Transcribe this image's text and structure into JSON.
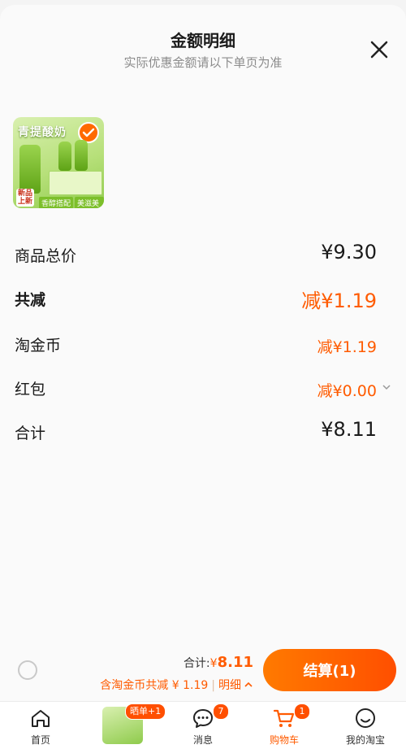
{
  "header": {
    "title": "金额明细",
    "subtitle": "实际优惠金额请以下单页为准",
    "close_icon": "close-icon"
  },
  "product": {
    "thumb_title": "青提酸奶",
    "new_tag": "新品\n上新",
    "tag1": "香醇搭配",
    "tag2": "美滋美味",
    "selected": true
  },
  "rows": {
    "total_label": "商品总价",
    "total_value": "¥9.30",
    "reduce_label": "共减",
    "reduce_value": "减¥1.19",
    "coin_label": "淘金币",
    "coin_value": "减¥1.19",
    "redpacket_label": "红包",
    "redpacket_value": "减¥0.00",
    "sum_label": "合计",
    "sum_value": "¥8.11"
  },
  "bottom_bar": {
    "sum_prefix": "合计:",
    "sum_currency": "¥",
    "sum_amount": "8.11",
    "discount_text": "含淘金币共减 ¥ 1.19",
    "detail_link": "明细",
    "checkout_label": "结算(1)"
  },
  "tabs": [
    {
      "label": "首页",
      "icon": "home-icon"
    },
    {
      "label": "",
      "icon": "product-thumbnail",
      "badge": "晒单+1"
    },
    {
      "label": "消息",
      "icon": "message-icon",
      "badge": "7"
    },
    {
      "label": "购物车",
      "icon": "cart-icon",
      "badge": "1"
    },
    {
      "label": "我的淘宝",
      "icon": "profile-icon"
    }
  ],
  "colors": {
    "accent": "#ff5b00",
    "green": "#8fcb4c"
  }
}
